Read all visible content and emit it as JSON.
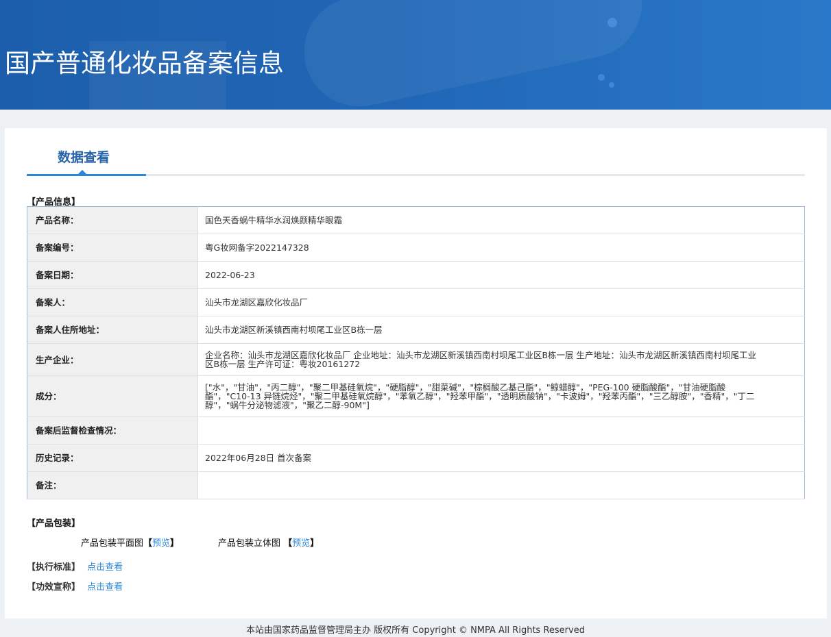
{
  "header": {
    "title": "国产普通化妆品备案信息"
  },
  "tab": {
    "label": "数据查看"
  },
  "product_info": {
    "section_title": "【产品信息】",
    "rows": [
      {
        "label": "产品名称：",
        "value": "国色天香蜗牛精华水润焕颜精华眼霜"
      },
      {
        "label": "备案编号：",
        "value": "粤G妆网备字2022147328"
      },
      {
        "label": "备案日期：",
        "value": "2022-06-23"
      },
      {
        "label": "备案人：",
        "value": "汕头市龙湖区嘉欣化妆品厂"
      },
      {
        "label": "备案人住所地址：",
        "value": "汕头市龙湖区新溪镇西南村坝尾工业区B栋一层"
      },
      {
        "label": "生产企业：",
        "value": "企业名称：汕头市龙湖区嘉欣化妆品厂 企业地址：汕头市龙湖区新溪镇西南村坝尾工业区B栋一层 生产地址：汕头市龙湖区新溪镇西南村坝尾工业区B栋一层 生产许可证：粤妆20161272"
      },
      {
        "label": "成分：",
        "value": "[\"水\"，\"甘油\"，\"丙二醇\"，\"聚二甲基硅氧烷\"，\"硬脂醇\"，\"甜菜碱\"，\"棕榈酸乙基己酯\"，\"鲸蜡醇\"，\"PEG-100 硬脂酸酯\"，\"甘油硬脂酸酯\"，\"C10-13 异链烷烃\"，\"聚二甲基硅氧烷醇\"，\"苯氧乙醇\"，\"羟苯甲酯\"，\"透明质酸钠\"，\"卡波姆\"，\"羟苯丙酯\"，\"三乙醇胺\"，\"香精\"，\"丁二醇\"，\"蜗牛分泌物滤液\"，\"聚乙二醇-90M\"]"
      },
      {
        "label": "备案后监督检查情况：",
        "value": ""
      },
      {
        "label": "历史记录：",
        "value": "2022年06月28日 首次备案"
      },
      {
        "label": "备注：",
        "value": ""
      }
    ]
  },
  "packaging": {
    "section_title": "【产品包装】",
    "flat_label": "产品包装平面图",
    "solid_label": "产品包装立体图",
    "bracket_open": "【",
    "bracket_close": "】",
    "preview": "预览"
  },
  "standard": {
    "label": "【执行标准】",
    "link": "点击查看"
  },
  "efficacy": {
    "label": "【功效宣称】",
    "link": "点击查看"
  },
  "footer": {
    "text": "本站由国家药品监督管理局主办 版权所有 Copyright © NMPA All Rights Reserved"
  }
}
